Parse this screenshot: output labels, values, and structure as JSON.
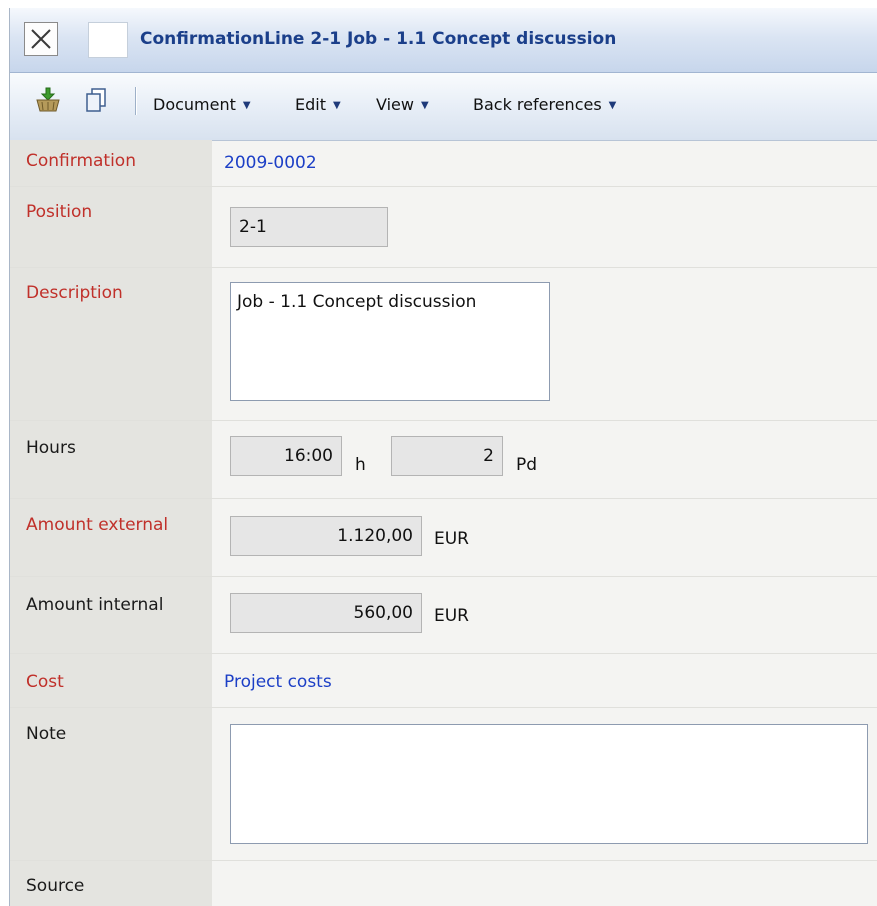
{
  "window": {
    "title": "ConfirmationLine 2-1 Job - 1.1 Concept discussion"
  },
  "toolbar": {
    "icons": [
      "basket-add-icon",
      "copy-icon"
    ],
    "menus": [
      "Document",
      "Edit",
      "View",
      "Back references"
    ]
  },
  "form": {
    "confirmation": {
      "label": "Confirmation",
      "value": "2009-0002"
    },
    "position": {
      "label": "Position",
      "value": "2-1"
    },
    "description": {
      "label": "Description",
      "value": "Job - 1.1  Concept discussion"
    },
    "hours": {
      "label": "Hours",
      "value": "16:00",
      "unit": "h",
      "days": "2",
      "days_unit": "Pd"
    },
    "amount_external": {
      "label": "Amount external",
      "value": "1.120,00",
      "currency": "EUR"
    },
    "amount_internal": {
      "label": "Amount internal",
      "value": "560,00",
      "currency": "EUR"
    },
    "cost": {
      "label": "Cost",
      "value": "Project costs"
    },
    "note": {
      "label": "Note",
      "value": ""
    },
    "source": {
      "label": "Source"
    }
  },
  "colors": {
    "required_label": "#c0302a",
    "link": "#1c3fc6",
    "title": "#1b3f8a"
  }
}
